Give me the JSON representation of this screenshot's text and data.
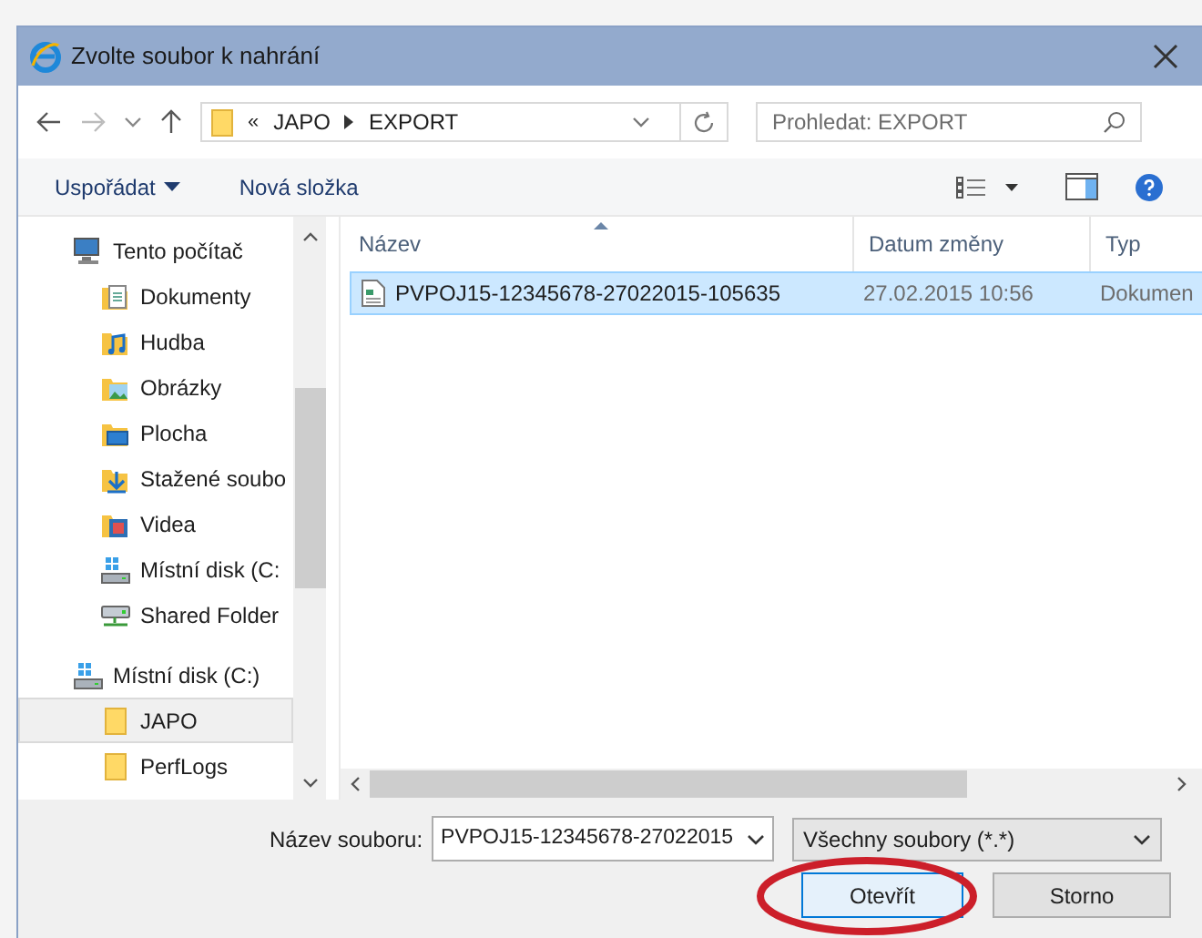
{
  "window": {
    "title": "Zvolte soubor k nahrání"
  },
  "address": {
    "path": [
      {
        "label": "JAPO"
      },
      {
        "label": "EXPORT"
      }
    ],
    "overflow": "«"
  },
  "search": {
    "placeholder": "Prohledat: EXPORT"
  },
  "toolbar": {
    "organize": "Uspořádat",
    "new_folder": "Nová složka"
  },
  "sidebar": {
    "items": [
      {
        "label": "Tento počítač",
        "kind": "computer",
        "selected": false,
        "children": [
          {
            "label": "Dokumenty",
            "kind": "documents",
            "selected": false
          },
          {
            "label": "Hudba",
            "kind": "music",
            "selected": false
          },
          {
            "label": "Obrázky",
            "kind": "pictures",
            "selected": false
          },
          {
            "label": "Plocha",
            "kind": "desktop",
            "selected": false
          },
          {
            "label": "Stažené soubo",
            "kind": "downloads",
            "selected": false
          },
          {
            "label": "Videa",
            "kind": "videos",
            "selected": false
          },
          {
            "label": "Místní disk (C:",
            "kind": "drive",
            "selected": false
          },
          {
            "label": "Shared Folder",
            "kind": "network",
            "selected": false
          }
        ]
      },
      {
        "label": "Místní disk (C:)",
        "kind": "drive",
        "selected": false,
        "children": [
          {
            "label": "JAPO",
            "kind": "folder",
            "selected": true
          },
          {
            "label": "PerfLogs",
            "kind": "folder",
            "selected": false
          }
        ]
      }
    ]
  },
  "files": {
    "columns": [
      "Název",
      "Datum změny",
      "Typ"
    ],
    "rows": [
      {
        "name": "PVPOJ15-12345678-27022015-105635",
        "date": "27.02.2015 10:56",
        "type": "Dokumen",
        "selected": true
      }
    ]
  },
  "footer": {
    "filename_label": "Název souboru:",
    "filename": "PVPOJ15-12345678-27022015",
    "filter": "Všechny soubory (*.*)",
    "buttons": [
      {
        "label": "Otevřít",
        "default": true
      },
      {
        "label": "Storno",
        "default": false
      }
    ]
  }
}
